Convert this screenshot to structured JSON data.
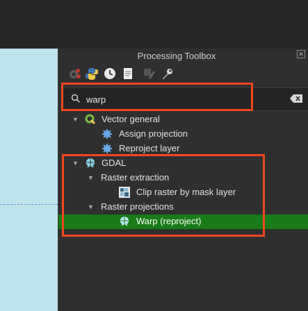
{
  "panel": {
    "title": "Processing Toolbox",
    "close_symbol": "✕"
  },
  "toolbar": {
    "icons": [
      "models-icon",
      "python-icon",
      "history-icon",
      "results-icon",
      "edit-features-icon",
      "options-icon"
    ]
  },
  "search": {
    "value": "warp",
    "placeholder": "Search…"
  },
  "tree": {
    "vector_general": {
      "label": "Vector general",
      "items": [
        "Assign projection",
        "Reproject layer"
      ]
    },
    "gdal": {
      "label": "GDAL",
      "raster_extraction": {
        "label": "Raster extraction",
        "items": [
          "Clip raster by mask layer"
        ]
      },
      "raster_projections": {
        "label": "Raster projections",
        "items": [
          "Warp (reproject)"
        ]
      }
    }
  },
  "colors": {
    "panel_bg": "#2f2f2f",
    "map_bg": "#bfe3ea",
    "selection": "#187a18",
    "annotation": "#f0481c"
  }
}
